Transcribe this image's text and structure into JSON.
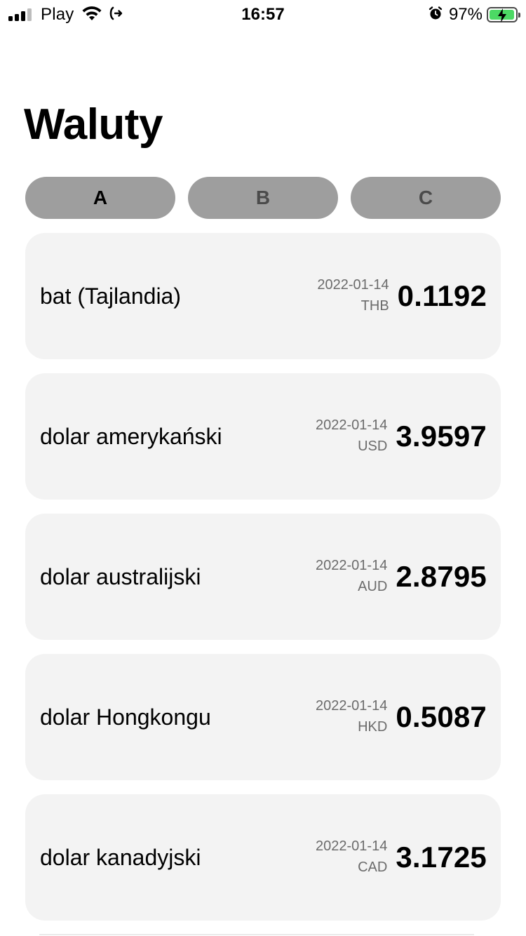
{
  "status_bar": {
    "carrier": "Play",
    "time": "16:57",
    "battery_percent": "97%",
    "battery_level": 0.97,
    "signal_bars": 3,
    "icons": [
      "signal-icon",
      "wifi-icon",
      "call-forwarding-icon",
      "alarm-icon",
      "battery-charging-icon"
    ]
  },
  "page": {
    "title": "Waluty"
  },
  "tabs": [
    {
      "label": "A",
      "active": true
    },
    {
      "label": "B",
      "active": false
    },
    {
      "label": "C",
      "active": false
    }
  ],
  "currencies": [
    {
      "name": "bat (Tajlandia)",
      "date": "2022-01-14",
      "code": "THB",
      "rate": "0.1192"
    },
    {
      "name": "dolar amerykański",
      "date": "2022-01-14",
      "code": "USD",
      "rate": "3.9597"
    },
    {
      "name": "dolar australijski",
      "date": "2022-01-14",
      "code": "AUD",
      "rate": "2.8795"
    },
    {
      "name": "dolar Hongkongu",
      "date": "2022-01-14",
      "code": "HKD",
      "rate": "0.5087"
    },
    {
      "name": "dolar kanadyjski",
      "date": "2022-01-14",
      "code": "CAD",
      "rate": "3.1725"
    }
  ],
  "colors": {
    "tab_background": "#9e9e9e",
    "card_background": "#f3f3f3",
    "battery_fill": "#4cd964"
  }
}
